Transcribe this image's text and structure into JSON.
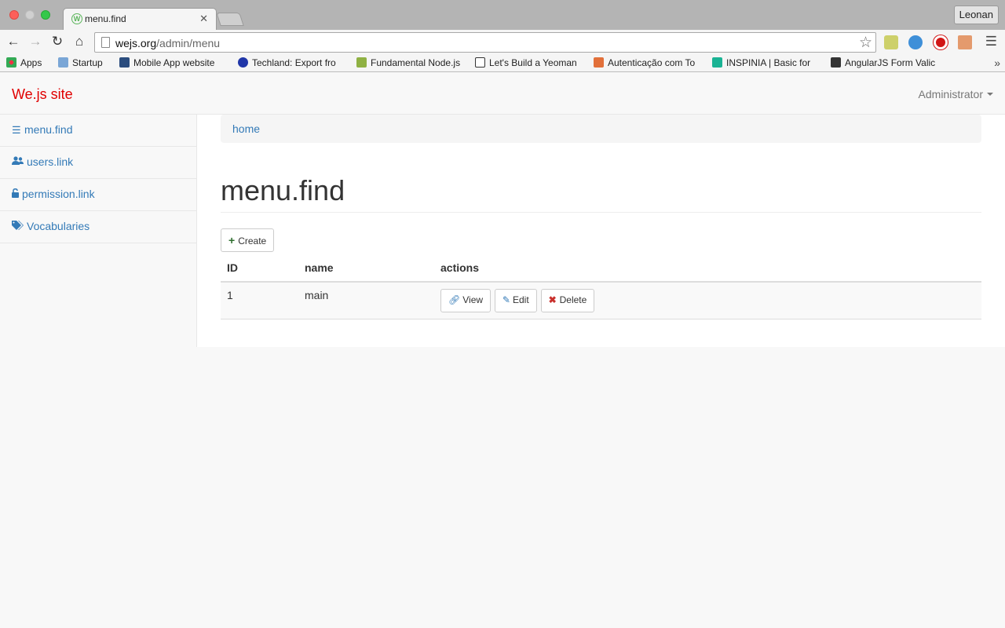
{
  "browser": {
    "tab_title": "menu.find",
    "profile_name": "Leonan",
    "url_host": "wejs.org",
    "url_path": "/admin/menu",
    "bookmarks": [
      "Apps",
      "Startup",
      "Mobile App website",
      "Techland: Export fro",
      "Fundamental Node.js",
      "Let's Build a Yeoman",
      "Autenticação com To",
      "INSPINIA | Basic for",
      "AngularJS Form Valic"
    ],
    "more_bookmarks": "»"
  },
  "navbar": {
    "brand": "We.js site",
    "user": "Administrator"
  },
  "sidebar": {
    "items": [
      {
        "label": "menu.find",
        "icon": "bars-icon"
      },
      {
        "label": "users.link",
        "icon": "users-icon"
      },
      {
        "label": "permission.link",
        "icon": "unlock-icon"
      },
      {
        "label": "Vocabularies",
        "icon": "tags-icon"
      }
    ]
  },
  "main": {
    "breadcrumb": "home",
    "title": "menu.find",
    "create_label": "Create",
    "table": {
      "columns": [
        "ID",
        "name",
        "actions"
      ],
      "rows": [
        {
          "id": "1",
          "name": "main"
        }
      ],
      "actions": {
        "view": "View",
        "edit": "Edit",
        "delete": "Delete"
      }
    }
  },
  "colors": {
    "brand": "#e00000",
    "link": "#337ab7",
    "create_icon": "#2f6f2f",
    "delete_icon": "#c9302c"
  }
}
